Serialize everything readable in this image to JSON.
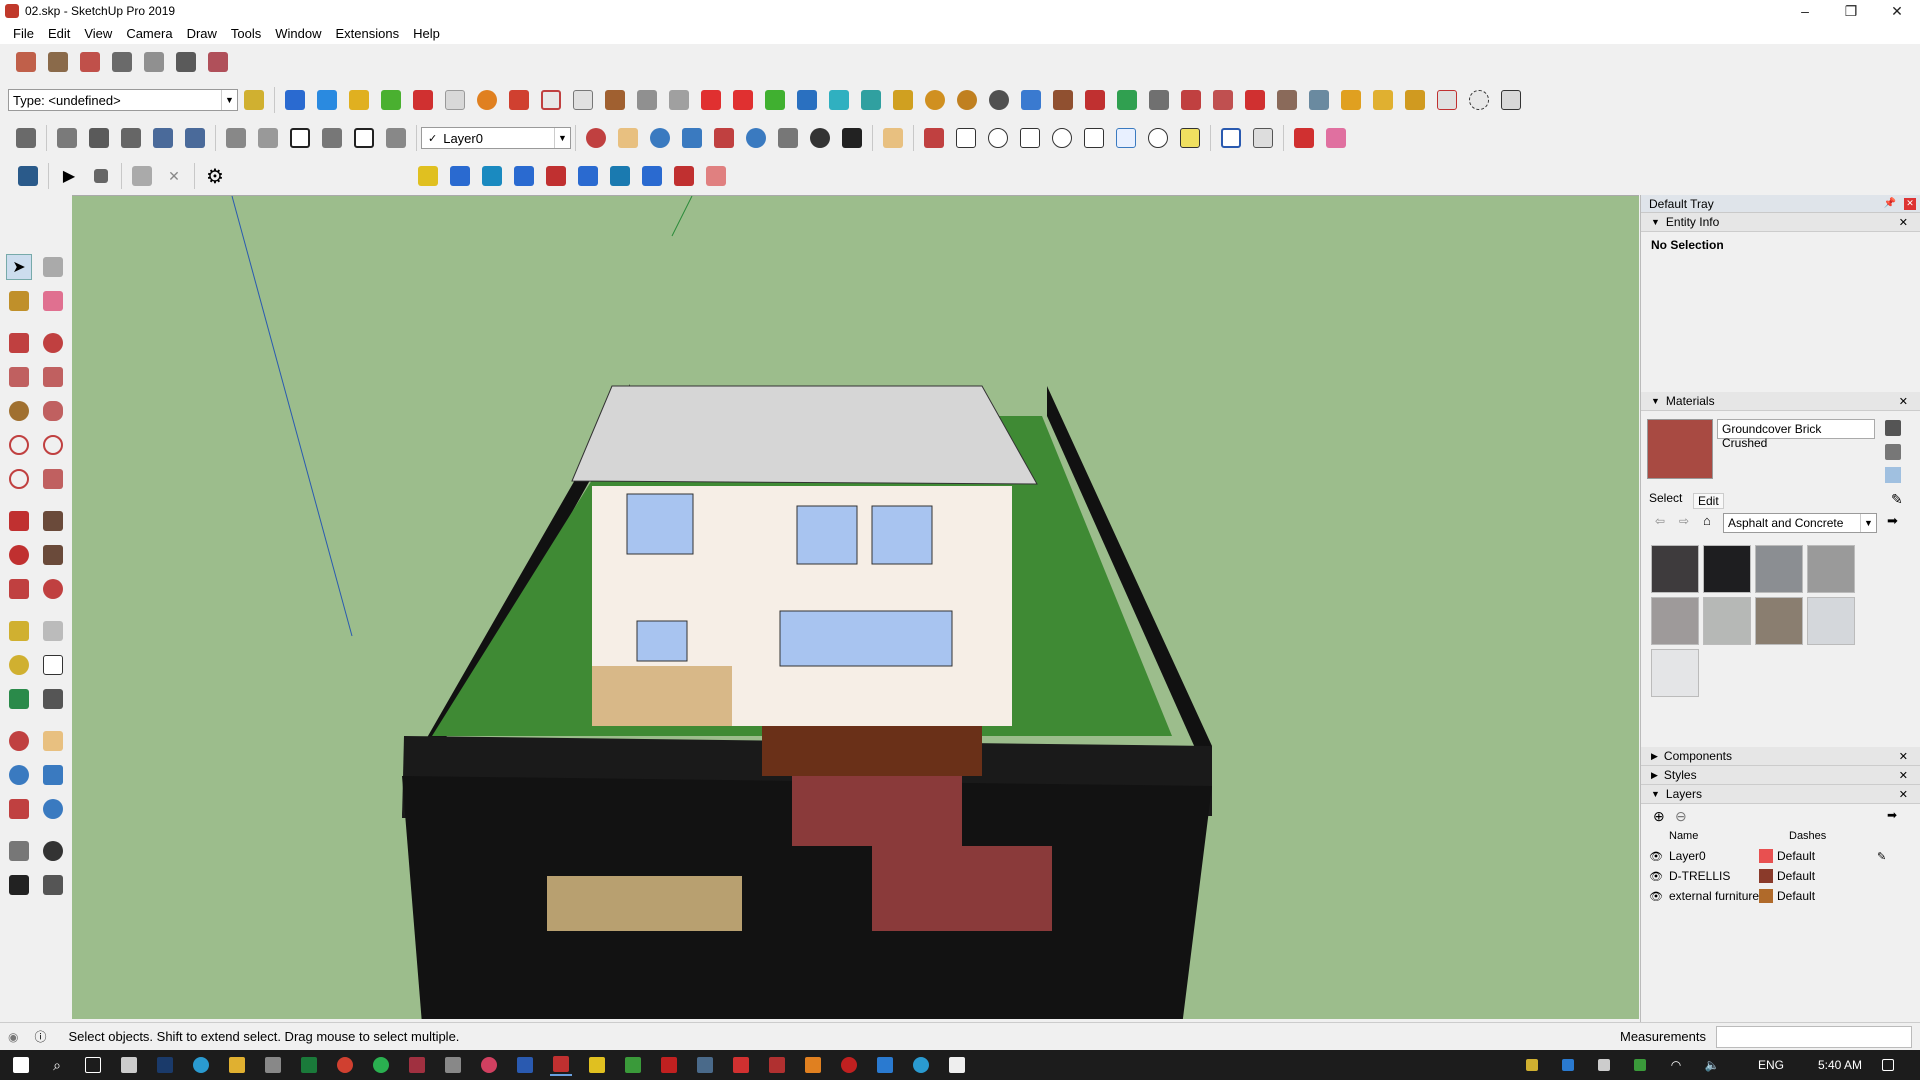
{
  "window": {
    "title": "02.skp - SketchUp Pro 2019",
    "controls": [
      "–",
      "❐",
      "✕"
    ]
  },
  "menu": [
    "File",
    "Edit",
    "View",
    "Camera",
    "Draw",
    "Tools",
    "Window",
    "Extensions",
    "Help"
  ],
  "toolbar": {
    "type_combo": "Type: <undefined>",
    "layer_combo": "Layer0"
  },
  "tray": {
    "title": "Default Tray",
    "entity_info": {
      "header": "Entity Info",
      "value": "No Selection"
    },
    "materials": {
      "header": "Materials",
      "current_name": "Groundcover Brick Crushed",
      "tabs": [
        "Select",
        "Edit"
      ],
      "library": "Asphalt and Concrete",
      "swatch_colors": [
        "#3e3b3d",
        "#1e1e20",
        "#8b8e92",
        "#9a9a9a",
        "#9e9a9a",
        "#b6b8b6",
        "#8a7e70",
        "#d4d7db",
        "#e4e5e7"
      ]
    },
    "components": "Components",
    "styles": "Styles",
    "layers": {
      "header": "Layers",
      "col_name": "Name",
      "col_dashes": "Dashes",
      "rows": [
        {
          "name": "Layer0",
          "dashes": "Default",
          "color": "#e85050"
        },
        {
          "name": "D-TRELLIS",
          "dashes": "Default",
          "color": "#8a3a2a"
        },
        {
          "name": "external furniture",
          "dashes": "Default",
          "color": "#b06a2a"
        }
      ]
    }
  },
  "status": {
    "text": "Select objects. Shift to extend select. Drag mouse to select multiple.",
    "measurements_label": "Measurements"
  },
  "taskbar": {
    "lang": "ENG",
    "time": "5:40 AM"
  }
}
